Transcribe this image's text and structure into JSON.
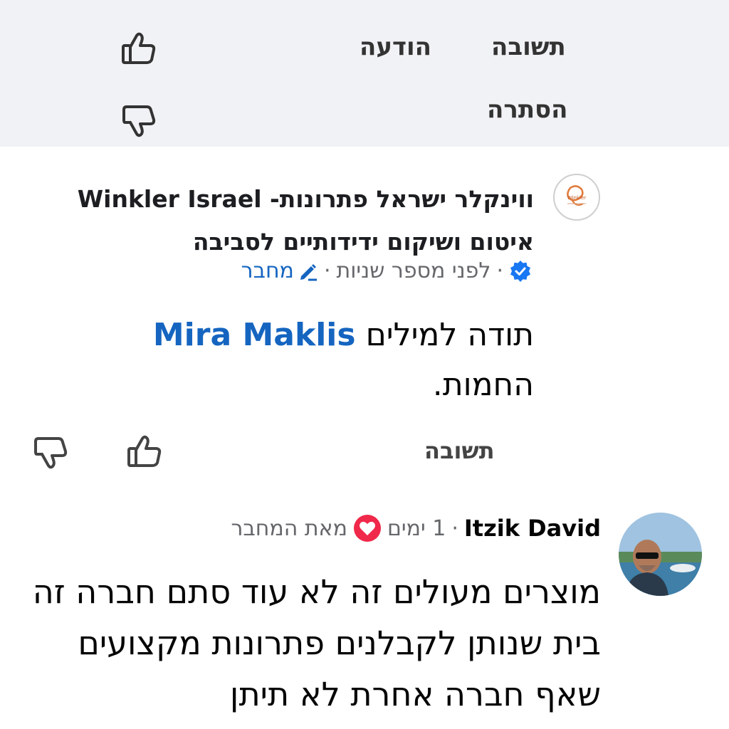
{
  "top_actions": {
    "reply": "תשובה",
    "report": "הודעה",
    "hide": "הסתרה"
  },
  "reply1": {
    "page_name": "ווינקלר ישראל פתרונות- Winkler Israel איטום ושיקום ידידותיים לסביבה",
    "time": "לפני מספר שניות",
    "author_label": "מחבר",
    "mention": "Mira Maklis",
    "text_before": "תודה למילים",
    "text_after": "החמות.",
    "reply_label": "תשובה",
    "avatar_logo_text": "Winkler"
  },
  "comment2": {
    "name": "Itzik David",
    "time": "1 ימים",
    "from_author": "מאת המחבר",
    "text": "מוצרים מעולים זה לא עוד סתם חברה זה בית שנותן לקבלנים פתרונות מקצועים שאף חברה אחרת לא תיתן"
  },
  "colors": {
    "accent_blue": "#1565c0",
    "heart_red": "#f0284a",
    "top_bg": "#f0f2f5",
    "verified_blue": "#1877f2"
  },
  "icons": [
    "thumbs-up-icon",
    "thumbs-down-icon",
    "verified-badge-icon",
    "pencil-icon",
    "heart-reaction-icon"
  ]
}
